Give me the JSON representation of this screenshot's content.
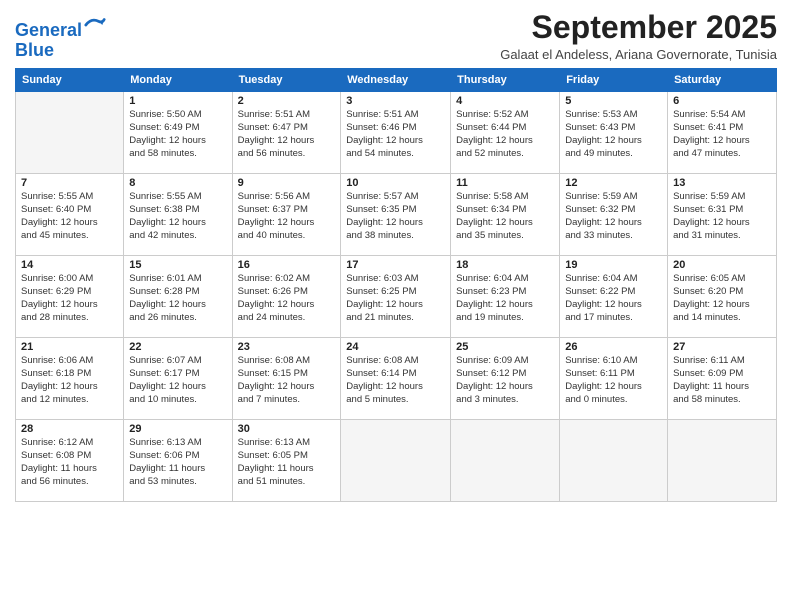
{
  "logo": {
    "line1": "General",
    "line2": "Blue"
  },
  "title": "September 2025",
  "subtitle": "Galaat el Andeless, Ariana Governorate, Tunisia",
  "headers": [
    "Sunday",
    "Monday",
    "Tuesday",
    "Wednesday",
    "Thursday",
    "Friday",
    "Saturday"
  ],
  "weeks": [
    [
      {
        "day": "",
        "info": ""
      },
      {
        "day": "1",
        "info": "Sunrise: 5:50 AM\nSunset: 6:49 PM\nDaylight: 12 hours\nand 58 minutes."
      },
      {
        "day": "2",
        "info": "Sunrise: 5:51 AM\nSunset: 6:47 PM\nDaylight: 12 hours\nand 56 minutes."
      },
      {
        "day": "3",
        "info": "Sunrise: 5:51 AM\nSunset: 6:46 PM\nDaylight: 12 hours\nand 54 minutes."
      },
      {
        "day": "4",
        "info": "Sunrise: 5:52 AM\nSunset: 6:44 PM\nDaylight: 12 hours\nand 52 minutes."
      },
      {
        "day": "5",
        "info": "Sunrise: 5:53 AM\nSunset: 6:43 PM\nDaylight: 12 hours\nand 49 minutes."
      },
      {
        "day": "6",
        "info": "Sunrise: 5:54 AM\nSunset: 6:41 PM\nDaylight: 12 hours\nand 47 minutes."
      }
    ],
    [
      {
        "day": "7",
        "info": "Sunrise: 5:55 AM\nSunset: 6:40 PM\nDaylight: 12 hours\nand 45 minutes."
      },
      {
        "day": "8",
        "info": "Sunrise: 5:55 AM\nSunset: 6:38 PM\nDaylight: 12 hours\nand 42 minutes."
      },
      {
        "day": "9",
        "info": "Sunrise: 5:56 AM\nSunset: 6:37 PM\nDaylight: 12 hours\nand 40 minutes."
      },
      {
        "day": "10",
        "info": "Sunrise: 5:57 AM\nSunset: 6:35 PM\nDaylight: 12 hours\nand 38 minutes."
      },
      {
        "day": "11",
        "info": "Sunrise: 5:58 AM\nSunset: 6:34 PM\nDaylight: 12 hours\nand 35 minutes."
      },
      {
        "day": "12",
        "info": "Sunrise: 5:59 AM\nSunset: 6:32 PM\nDaylight: 12 hours\nand 33 minutes."
      },
      {
        "day": "13",
        "info": "Sunrise: 5:59 AM\nSunset: 6:31 PM\nDaylight: 12 hours\nand 31 minutes."
      }
    ],
    [
      {
        "day": "14",
        "info": "Sunrise: 6:00 AM\nSunset: 6:29 PM\nDaylight: 12 hours\nand 28 minutes."
      },
      {
        "day": "15",
        "info": "Sunrise: 6:01 AM\nSunset: 6:28 PM\nDaylight: 12 hours\nand 26 minutes."
      },
      {
        "day": "16",
        "info": "Sunrise: 6:02 AM\nSunset: 6:26 PM\nDaylight: 12 hours\nand 24 minutes."
      },
      {
        "day": "17",
        "info": "Sunrise: 6:03 AM\nSunset: 6:25 PM\nDaylight: 12 hours\nand 21 minutes."
      },
      {
        "day": "18",
        "info": "Sunrise: 6:04 AM\nSunset: 6:23 PM\nDaylight: 12 hours\nand 19 minutes."
      },
      {
        "day": "19",
        "info": "Sunrise: 6:04 AM\nSunset: 6:22 PM\nDaylight: 12 hours\nand 17 minutes."
      },
      {
        "day": "20",
        "info": "Sunrise: 6:05 AM\nSunset: 6:20 PM\nDaylight: 12 hours\nand 14 minutes."
      }
    ],
    [
      {
        "day": "21",
        "info": "Sunrise: 6:06 AM\nSunset: 6:18 PM\nDaylight: 12 hours\nand 12 minutes."
      },
      {
        "day": "22",
        "info": "Sunrise: 6:07 AM\nSunset: 6:17 PM\nDaylight: 12 hours\nand 10 minutes."
      },
      {
        "day": "23",
        "info": "Sunrise: 6:08 AM\nSunset: 6:15 PM\nDaylight: 12 hours\nand 7 minutes."
      },
      {
        "day": "24",
        "info": "Sunrise: 6:08 AM\nSunset: 6:14 PM\nDaylight: 12 hours\nand 5 minutes."
      },
      {
        "day": "25",
        "info": "Sunrise: 6:09 AM\nSunset: 6:12 PM\nDaylight: 12 hours\nand 3 minutes."
      },
      {
        "day": "26",
        "info": "Sunrise: 6:10 AM\nSunset: 6:11 PM\nDaylight: 12 hours\nand 0 minutes."
      },
      {
        "day": "27",
        "info": "Sunrise: 6:11 AM\nSunset: 6:09 PM\nDaylight: 11 hours\nand 58 minutes."
      }
    ],
    [
      {
        "day": "28",
        "info": "Sunrise: 6:12 AM\nSunset: 6:08 PM\nDaylight: 11 hours\nand 56 minutes."
      },
      {
        "day": "29",
        "info": "Sunrise: 6:13 AM\nSunset: 6:06 PM\nDaylight: 11 hours\nand 53 minutes."
      },
      {
        "day": "30",
        "info": "Sunrise: 6:13 AM\nSunset: 6:05 PM\nDaylight: 11 hours\nand 51 minutes."
      },
      {
        "day": "",
        "info": ""
      },
      {
        "day": "",
        "info": ""
      },
      {
        "day": "",
        "info": ""
      },
      {
        "day": "",
        "info": ""
      }
    ]
  ]
}
